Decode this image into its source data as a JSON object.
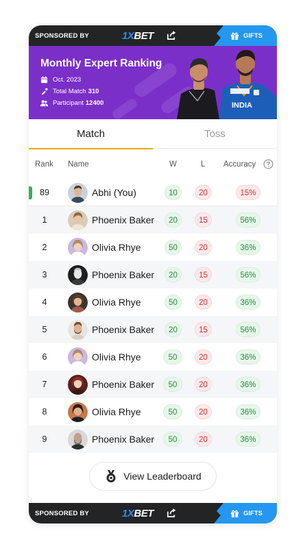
{
  "sponsor": {
    "label": "SPONSORED BY",
    "brand_prefix": "1X",
    "brand_suffix": "BET",
    "gifts_label": "GIFTS",
    "share_icon": "share-icon",
    "gift_icon": "gift-icon"
  },
  "banner": {
    "title": "Monthly Expert Ranking",
    "date": "Oct. 2023",
    "total_match_label": "Total Match",
    "total_match_value": "310",
    "participant_label": "Participant",
    "participant_value": "12400"
  },
  "tabs": [
    {
      "label": "Match",
      "active": true
    },
    {
      "label": "Toss",
      "active": false
    }
  ],
  "table": {
    "headers": {
      "rank": "Rank",
      "name": "Name",
      "w": "W",
      "l": "L",
      "accuracy": "Accuracy"
    },
    "current_user": {
      "rank": "89",
      "name": "Abhi (You)",
      "w": "10",
      "l": "20",
      "accuracy": "15%"
    },
    "rows": [
      {
        "rank": "1",
        "name": "Phoenix Baker",
        "w": "20",
        "l": "15",
        "accuracy": "56%"
      },
      {
        "rank": "2",
        "name": "Olivia Rhye",
        "w": "50",
        "l": "20",
        "accuracy": "36%"
      },
      {
        "rank": "3",
        "name": "Phoenix Baker",
        "w": "20",
        "l": "15",
        "accuracy": "56%"
      },
      {
        "rank": "4",
        "name": "Olivia Rhye",
        "w": "50",
        "l": "20",
        "accuracy": "36%"
      },
      {
        "rank": "5",
        "name": "Phoenix Baker",
        "w": "20",
        "l": "15",
        "accuracy": "56%"
      },
      {
        "rank": "6",
        "name": "Olivia Rhye",
        "w": "50",
        "l": "20",
        "accuracy": "36%"
      },
      {
        "rank": "7",
        "name": "Phoenix Baker",
        "w": "50",
        "l": "20",
        "accuracy": "36%"
      },
      {
        "rank": "8",
        "name": "Olivia Rhye",
        "w": "50",
        "l": "20",
        "accuracy": "36%"
      },
      {
        "rank": "9",
        "name": "Phoenix Baker",
        "w": "50",
        "l": "20",
        "accuracy": "36%"
      }
    ]
  },
  "leaderboard_button": {
    "label": "View Leaderboard",
    "icon": "medal-icon"
  },
  "colors": {
    "banner_purple": "#7b2fc9",
    "sponsor_dark": "#222426",
    "gifts_blue": "#2597f0",
    "tab_underline": "#f2a60c",
    "win_green": "#1f8f3d",
    "loss_red": "#d43339",
    "you_marker": "#34b24b"
  }
}
